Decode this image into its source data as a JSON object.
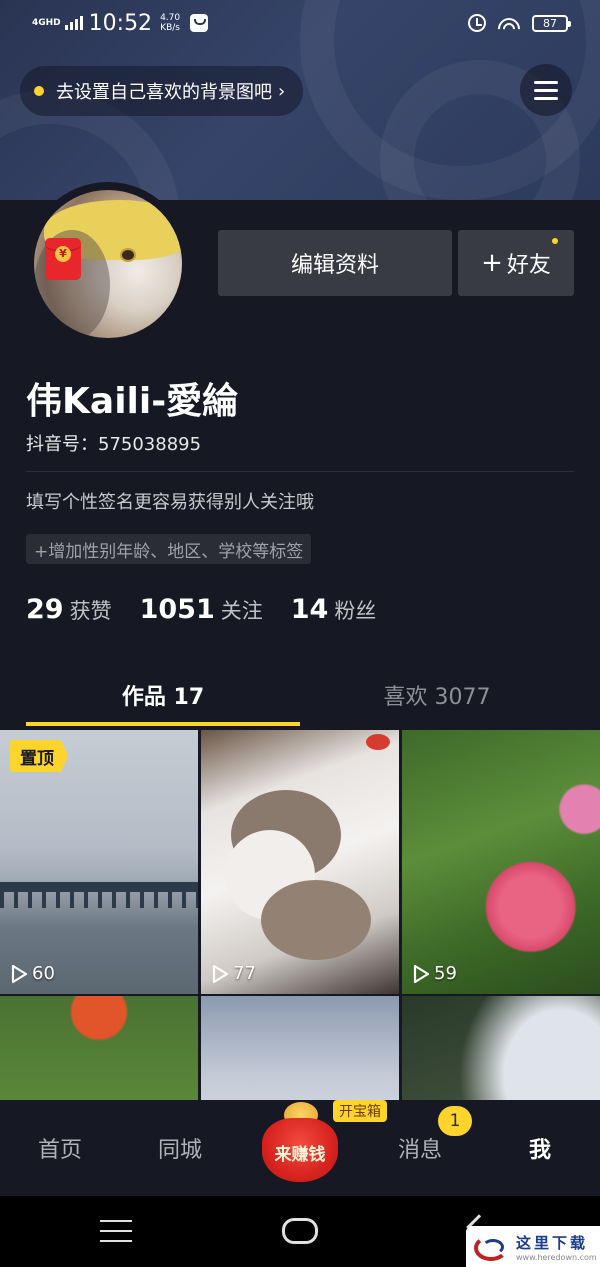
{
  "status_bar": {
    "network": "4GHD",
    "time": "10:52",
    "speed_value": "4.70",
    "speed_unit": "KB/s",
    "battery": "87"
  },
  "header": {
    "bg_hint": "去设置自己喜欢的背景图吧",
    "bg_hint_chevron": "›",
    "menu_icon": "hamburger-icon"
  },
  "profile": {
    "redpack_symbol": "¥",
    "edit_label": "编辑资料",
    "friend_plus": "+",
    "friend_label": "好友",
    "nickname": "伟Kaili-愛綸",
    "douyin_id": "抖音号：575038895",
    "signature": "填写个性签名更容易获得别人关注哦",
    "tag_prompt": "+增加性别年龄、地区、学校等标签"
  },
  "stats": [
    {
      "value": "29",
      "label": "获赞"
    },
    {
      "value": "1051",
      "label": "关注"
    },
    {
      "value": "14",
      "label": "粉丝"
    }
  ],
  "tabs": [
    {
      "label": "作品 17",
      "active": true
    },
    {
      "label": "喜欢 3077",
      "active": false
    }
  ],
  "videos": [
    {
      "plays": "60",
      "pinned_label": "置顶"
    },
    {
      "plays": "77"
    },
    {
      "plays": "59"
    },
    {
      "plays": ""
    },
    {
      "plays": ""
    },
    {
      "plays": ""
    }
  ],
  "bottom_nav": {
    "home": "首页",
    "city": "同城",
    "earn": "来赚钱",
    "treasure": "开宝箱",
    "messages": "消息",
    "messages_badge": "1",
    "me": "我"
  },
  "watermark": {
    "title": "这里下载",
    "url": "www.heredown.com"
  },
  "colors": {
    "accent": "#fdd42c",
    "background": "#161823",
    "button": "#393b44"
  }
}
